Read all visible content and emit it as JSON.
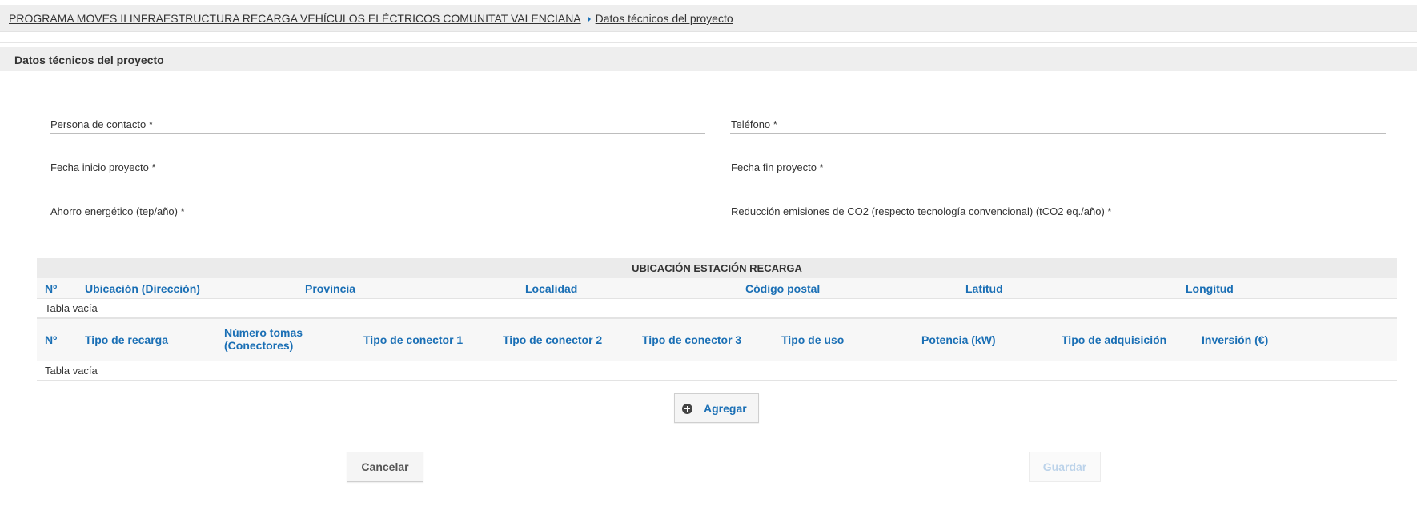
{
  "breadcrumb": {
    "parent": "PROGRAMA MOVES II INFRAESTRUCTURA RECARGA VEHÍCULOS ELÉCTRICOS COMUNITAT VALENCIANA",
    "current": "Datos técnicos del proyecto"
  },
  "section": {
    "title": "Datos técnicos del proyecto"
  },
  "fields": {
    "contact_person": "Persona de contacto *",
    "phone": "Teléfono *",
    "start_date": "Fecha inicio proyecto *",
    "end_date": "Fecha fin proyecto *",
    "energy_saving": "Ahorro energético (tep/año) *",
    "co2_reduction": "Reducción emisiones de CO2 (respecto tecnología convencional) (tCO2 eq./año) *"
  },
  "location_table": {
    "caption": "UBICACIÓN ESTACIÓN RECARGA",
    "columns": [
      "Nº",
      "Ubicación (Dirección)",
      "Provincia",
      "Localidad",
      "Código postal",
      "Latitud",
      "Longitud"
    ],
    "empty_text": "Tabla vacía"
  },
  "charging_table": {
    "columns": [
      "Nº",
      "Tipo de recarga",
      "Número tomas\n(Conectores)",
      "Tipo de conector 1",
      "Tipo de conector 2",
      "Tipo de conector 3",
      "Tipo de uso",
      "Potencia (kW)",
      "Tipo de adquisición",
      "Inversión (€)"
    ],
    "empty_text": "Tabla vacía"
  },
  "buttons": {
    "add": "Agregar",
    "cancel": "Cancelar",
    "save": "Guardar"
  },
  "icons": {
    "add": "plus-circle-icon",
    "breadcrumb_separator": "caret-right-icon"
  },
  "colors": {
    "accent": "#1a6fb5",
    "header_bg": "#eeeeee"
  }
}
